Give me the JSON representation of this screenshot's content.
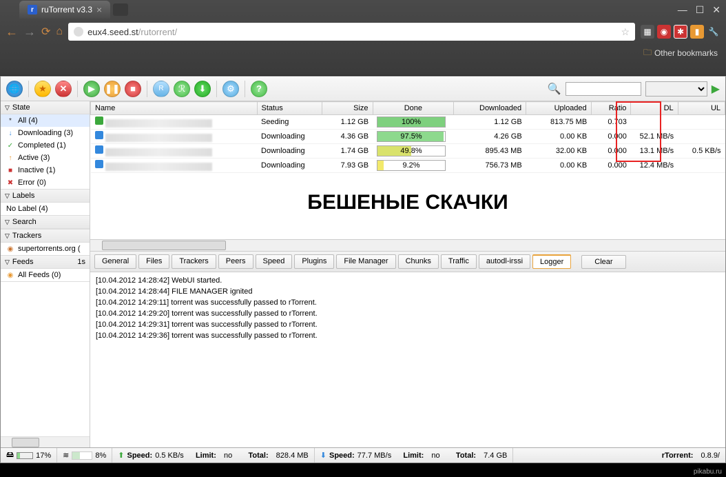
{
  "browser": {
    "tab_title": "ruTorrent v3.3",
    "url_domain": "eux4.seed.st",
    "url_path": "/rutorrent/",
    "bookmarks_label": "Other bookmarks"
  },
  "sidebar": {
    "sections": {
      "state": {
        "label": "State"
      },
      "labels": {
        "label": "Labels"
      },
      "search": {
        "label": "Search"
      },
      "trackers": {
        "label": "Trackers"
      },
      "feeds": {
        "label": "Feeds",
        "badge": "1s"
      }
    },
    "state_items": [
      {
        "label": "All (4)",
        "icon": "*",
        "color": "#333",
        "selected": true
      },
      {
        "label": "Downloading (3)",
        "icon": "↓",
        "color": "#3388dd"
      },
      {
        "label": "Completed (1)",
        "icon": "✓",
        "color": "#3ca83c"
      },
      {
        "label": "Active (3)",
        "icon": "↑",
        "color": "#e89933"
      },
      {
        "label": "Inactive (1)",
        "icon": "■",
        "color": "#cc3333"
      },
      {
        "label": "Error (0)",
        "icon": "✖",
        "color": "#cc3333"
      }
    ],
    "label_items": [
      {
        "label": "No Label (4)"
      }
    ],
    "tracker_items": [
      {
        "label": "supertorrents.org (",
        "icon": "◉",
        "color": "#cc7733"
      }
    ],
    "feed_items": [
      {
        "label": "All Feeds (0)",
        "icon": "◉",
        "color": "#e89933"
      }
    ]
  },
  "grid": {
    "columns": {
      "name": "Name",
      "status": "Status",
      "size": "Size",
      "done": "Done",
      "downloaded": "Downloaded",
      "uploaded": "Uploaded",
      "ratio": "Ratio",
      "dl": "DL",
      "ul": "UL"
    },
    "rows": [
      {
        "status": "Seeding",
        "icon": "seed",
        "size": "1.12 GB",
        "done_pct": 100,
        "done_label": "100%",
        "done_color": "#7ed07e",
        "downloaded": "1.12 GB",
        "uploaded": "813.75 MB",
        "ratio": "0.703",
        "dl": "",
        "ul": ""
      },
      {
        "status": "Downloading",
        "icon": "dl",
        "size": "4.36 GB",
        "done_pct": 97.5,
        "done_label": "97.5%",
        "done_color": "#8dd98d",
        "downloaded": "4.26 GB",
        "uploaded": "0.00 KB",
        "ratio": "0.000",
        "dl": "52.1 MB/s",
        "ul": ""
      },
      {
        "status": "Downloading",
        "icon": "dl",
        "size": "1.74 GB",
        "done_pct": 49.8,
        "done_label": "49.8%",
        "done_color": "#d9e26b",
        "downloaded": "895.43 MB",
        "uploaded": "32.00 KB",
        "ratio": "0.000",
        "dl": "13.1 MB/s",
        "ul": "0.5 KB/s"
      },
      {
        "status": "Downloading",
        "icon": "dl",
        "size": "7.93 GB",
        "done_pct": 9.2,
        "done_label": "9.2%",
        "done_color": "#f2e96b",
        "downloaded": "756.73 MB",
        "uploaded": "0.00 KB",
        "ratio": "0.000",
        "dl": "12.4 MB/s",
        "ul": ""
      }
    ]
  },
  "overlay": "БЕШЕНЫЕ СКАЧКИ",
  "detail_tabs": {
    "tabs": [
      "General",
      "Files",
      "Trackers",
      "Peers",
      "Speed",
      "Plugins",
      "File Manager",
      "Chunks",
      "Traffic",
      "autodl-irssi",
      "Logger"
    ],
    "active": "Logger",
    "clear": "Clear"
  },
  "log": [
    "[10.04.2012 14:28:42] WebUI started.",
    "[10.04.2012 14:28:44] FILE MANAGER ignited",
    "[10.04.2012 14:29:11] torrent was successfully passed to rTorrent.",
    "[10.04.2012 14:29:20] torrent was successfully passed to rTorrent.",
    "[10.04.2012 14:29:31] torrent was successfully passed to rTorrent.",
    "[10.04.2012 14:29:36] torrent was successfully passed to rTorrent."
  ],
  "status": {
    "disk_pct": 17,
    "disk_label": "17%",
    "mem_pct": 8,
    "mem_label": "8%",
    "up_speed_label": "Speed:",
    "up_speed": "0.5 KB/s",
    "up_limit_label": "Limit:",
    "up_limit": "no",
    "up_total_label": "Total:",
    "up_total": "828.4 MB",
    "dl_speed_label": "Speed:",
    "dl_speed": "77.7 MB/s",
    "dl_limit_label": "Limit:",
    "dl_limit": "no",
    "dl_total_label": "Total:",
    "dl_total": "7.4 GB",
    "client_label": "rTorrent:",
    "client_ver": "0.8.9/"
  },
  "watermark": "pikabu.ru"
}
